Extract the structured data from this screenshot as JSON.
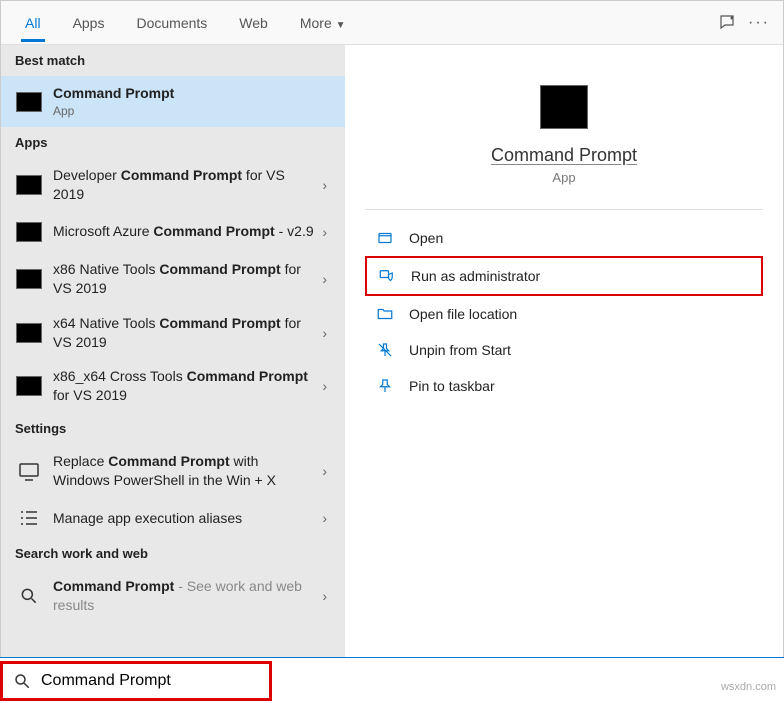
{
  "tabs": {
    "all": "All",
    "apps": "Apps",
    "documents": "Documents",
    "web": "Web",
    "more": "More"
  },
  "sections": {
    "best_match": "Best match",
    "apps": "Apps",
    "settings": "Settings",
    "search_web": "Search work and web"
  },
  "best_match": {
    "title": "Command Prompt",
    "type": "App"
  },
  "apps": [
    {
      "prefix": "Developer ",
      "bold": "Command Prompt",
      "suffix": " for VS 2019"
    },
    {
      "prefix": "Microsoft Azure ",
      "bold": "Command Prompt",
      "suffix": " - v2.9"
    },
    {
      "prefix": "x86 Native Tools ",
      "bold": "Command Prompt",
      "suffix": " for VS 2019"
    },
    {
      "prefix": "x64 Native Tools ",
      "bold": "Command Prompt",
      "suffix": " for VS 2019"
    },
    {
      "prefix": "x86_x64 Cross Tools ",
      "bold": "Command Prompt",
      "suffix": " for VS 2019"
    }
  ],
  "settings": [
    {
      "prefix": "Replace ",
      "bold": "Command Prompt",
      "suffix": " with Windows PowerShell in the Win + X",
      "icon": "monitor"
    },
    {
      "prefix": "Manage app execution aliases",
      "bold": "",
      "suffix": "",
      "icon": "list"
    }
  ],
  "search_web": {
    "title": "Command Prompt",
    "hint": " - See work and web results"
  },
  "details": {
    "title": "Command Prompt",
    "subtitle": "App"
  },
  "actions": {
    "open": "Open",
    "run_admin": "Run as administrator",
    "open_location": "Open file location",
    "unpin_start": "Unpin from Start",
    "pin_taskbar": "Pin to taskbar"
  },
  "search": {
    "value": "Command Prompt"
  },
  "watermark": "wsxdn.com"
}
